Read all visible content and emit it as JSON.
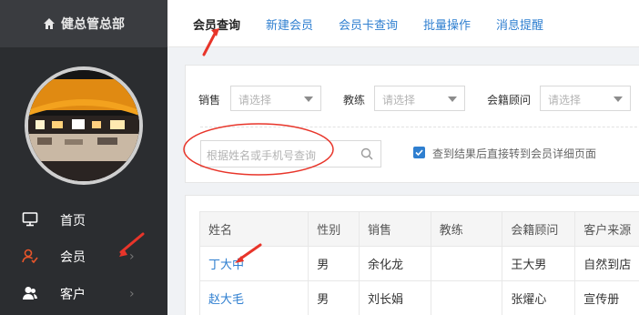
{
  "sidebar": {
    "title": "健总管总部",
    "items": [
      {
        "label": "首页",
        "icon": "monitor-icon"
      },
      {
        "label": "会员",
        "icon": "member-icon"
      },
      {
        "label": "客户",
        "icon": "customer-icon"
      }
    ]
  },
  "tabs": [
    "会员查询",
    "新建会员",
    "会员卡查询",
    "批量操作",
    "消息提醒"
  ],
  "filters": {
    "sales_label": "销售",
    "coach_label": "教练",
    "advisor_label": "会籍顾问",
    "select_placeholder": "请选择",
    "search_placeholder": "根据姓名或手机号查询",
    "jump_checkbox_label": "查到结果后直接转到会员详细页面"
  },
  "table": {
    "headers": [
      "姓名",
      "性别",
      "销售",
      "教练",
      "会籍顾问",
      "客户来源"
    ],
    "rows": [
      [
        "丁大中",
        "男",
        "余化龙",
        "",
        "王大男",
        "自然到店"
      ],
      [
        "赵大毛",
        "男",
        "刘长娟",
        "",
        "张燿心",
        "宣传册"
      ]
    ]
  },
  "colors": {
    "accent": "#2f7fd0",
    "sidebar": "#2b2d30",
    "annotation": "#e8352a",
    "active_icon": "#e8552a"
  }
}
